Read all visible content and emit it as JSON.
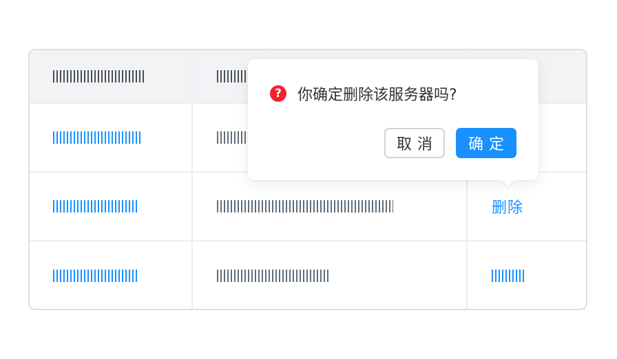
{
  "table": {
    "header": {
      "col1_placeholder": "IIIIIIIIIIIIIIIIIIIII",
      "col2_placeholder": "IIIIIIIIIIIIIIIIIIIIII"
    },
    "rows": [
      {
        "col1": "IIIIIIIIIIIIIIIIIIIII",
        "col2": "IIIIIIIIIIIIIIIII",
        "action": ""
      },
      {
        "col1": "IIIIIIIIIIIIIIIIIIII",
        "col2": "IIIIIIIIIIIIIIIIIIIIIIIIIIIIIIIIIIIIIIIIIII",
        "action": "删除"
      },
      {
        "col1": "IIIIIIIIIIIIIIIIIIII",
        "col2": "IIIIIIIIIIIIIIIIIIIIIIIIIIII",
        "action": "IIIIIIIIII"
      }
    ]
  },
  "popconfirm": {
    "icon": "question-circle-icon",
    "icon_glyph": "?",
    "icon_color": "#f5222d",
    "message": "你确定删除该服务器吗?",
    "cancel_label": "取消",
    "confirm_label": "确定"
  },
  "colors": {
    "primary": "#1890ff",
    "border": "#dcdee3",
    "header_bg": "#f2f3f5"
  }
}
